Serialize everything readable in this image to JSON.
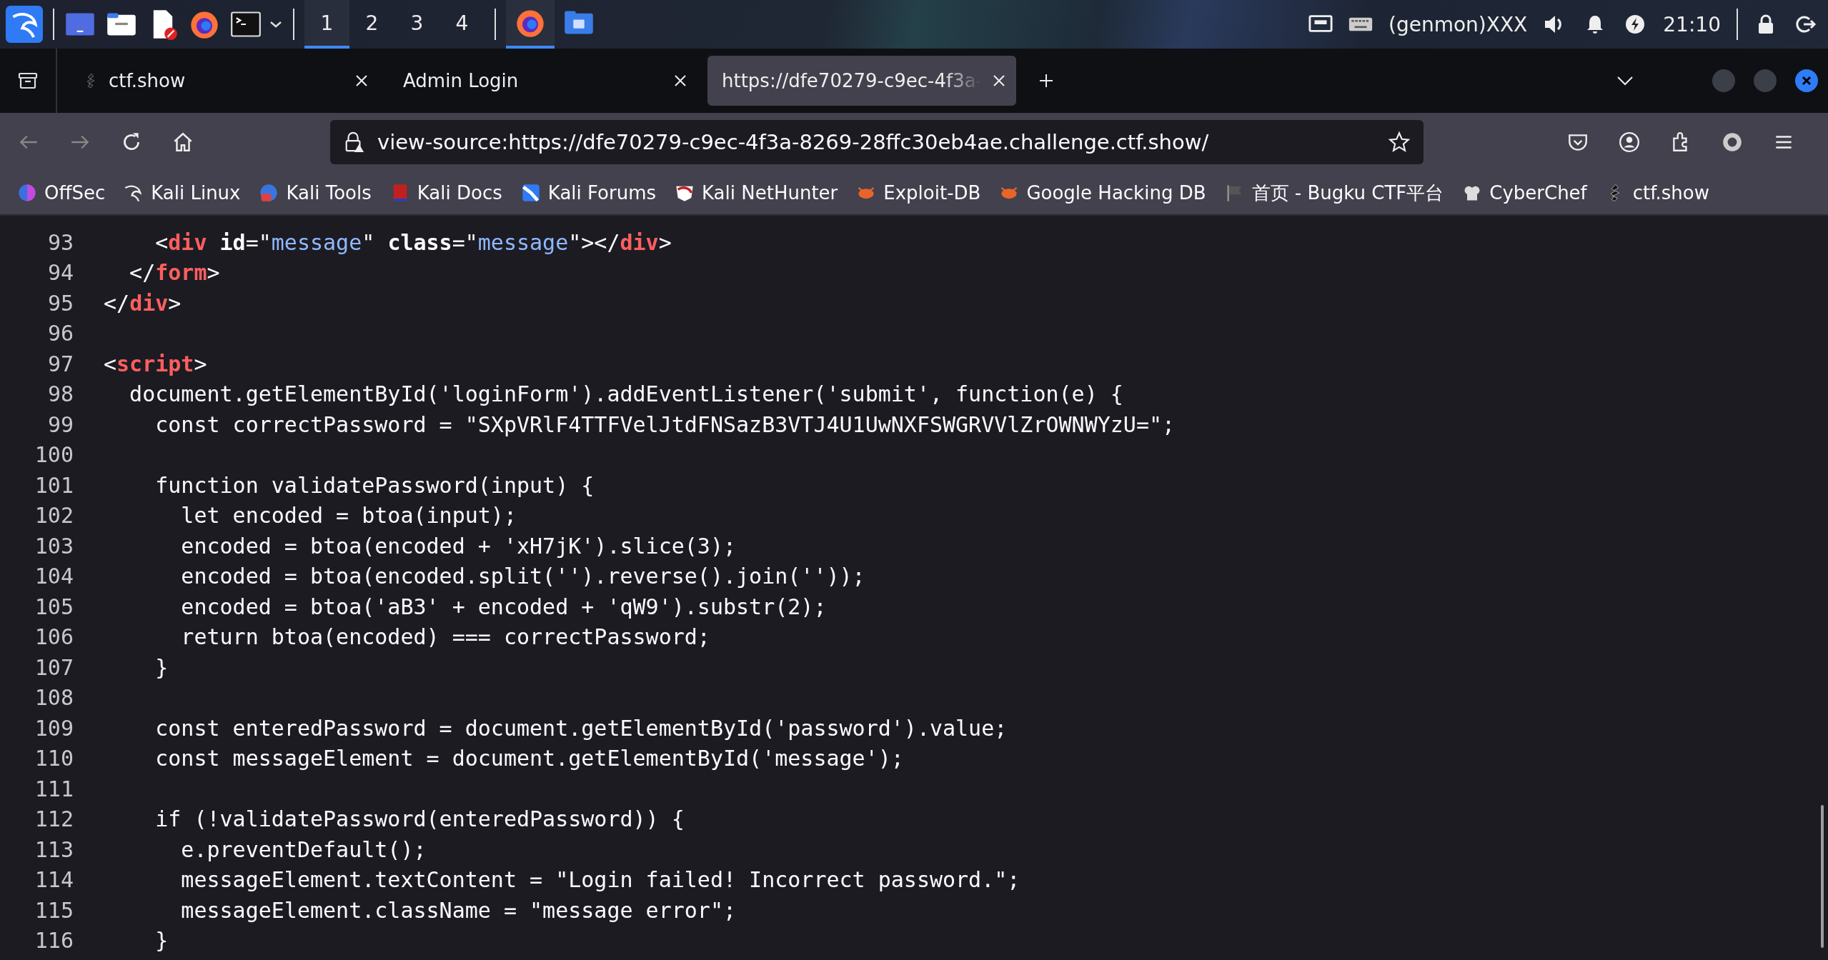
{
  "taskbar": {
    "workspaces": [
      {
        "label": "1",
        "selected": true
      },
      {
        "label": "2",
        "selected": false
      },
      {
        "label": "3",
        "selected": false
      },
      {
        "label": "4",
        "selected": false
      }
    ],
    "windows": [
      {
        "selected": true
      },
      {
        "selected": false
      }
    ],
    "genmon": "(genmon)XXX",
    "clock": "21:10"
  },
  "tabs": [
    {
      "label": "ctf.show",
      "selected": false
    },
    {
      "label": "Admin Login",
      "selected": false
    },
    {
      "label": "https://dfe70279-c9ec-4f3a-",
      "selected": true
    }
  ],
  "address": "view-source:https://dfe70279-c9ec-4f3a-8269-28ffc30eb4ae.challenge.ctf.show/",
  "bookmarks": [
    "OffSec",
    "Kali Linux",
    "Kali Tools",
    "Kali Docs",
    "Kali Forums",
    "Kali NetHunter",
    "Exploit-DB",
    "Google Hacking DB",
    "首页 - Bugku CTF平台",
    "CyberChef",
    "ctf.show"
  ],
  "code_lines": [
    {
      "number": "93",
      "tokens": [
        {
          "kind": "text",
          "text": "    <"
        },
        {
          "kind": "tag",
          "text": "div"
        },
        {
          "kind": "attr",
          "text": " id"
        },
        {
          "kind": "text",
          "text": "=\""
        },
        {
          "kind": "value",
          "text": "message"
        },
        {
          "kind": "text",
          "text": "\" "
        },
        {
          "kind": "attr",
          "text": "class"
        },
        {
          "kind": "text",
          "text": "=\""
        },
        {
          "kind": "value",
          "text": "message"
        },
        {
          "kind": "text",
          "text": "\"></"
        },
        {
          "kind": "tag",
          "text": "div"
        },
        {
          "kind": "text",
          "text": ">"
        }
      ]
    },
    {
      "number": "94",
      "tokens": [
        {
          "kind": "text",
          "text": "  </"
        },
        {
          "kind": "tag",
          "text": "form"
        },
        {
          "kind": "text",
          "text": ">"
        }
      ]
    },
    {
      "number": "95",
      "tokens": [
        {
          "kind": "text",
          "text": "</"
        },
        {
          "kind": "tag",
          "text": "div"
        },
        {
          "kind": "text",
          "text": ">"
        }
      ]
    },
    {
      "number": "96"
    },
    {
      "number": "97",
      "tokens": [
        {
          "kind": "text",
          "text": "<"
        },
        {
          "kind": "tag",
          "text": "script"
        },
        {
          "kind": "text",
          "text": ">"
        }
      ]
    },
    {
      "number": "98",
      "tokens": [
        {
          "kind": "text",
          "text": "  document.getElementById('loginForm').addEventListener('submit', function(e) {"
        }
      ]
    },
    {
      "number": "99",
      "tokens": [
        {
          "kind": "text",
          "text": "    const correctPassword = \"SXpVRlF4TTFVelJtdFNSazB3VTJ4U1UwNXFSWGRVVlZrOWNWYzU=\";"
        }
      ]
    },
    {
      "number": "100"
    },
    {
      "number": "101",
      "tokens": [
        {
          "kind": "text",
          "text": "    function validatePassword(input) {"
        }
      ]
    },
    {
      "number": "102",
      "tokens": [
        {
          "kind": "text",
          "text": "      let encoded = btoa(input);"
        }
      ]
    },
    {
      "number": "103",
      "tokens": [
        {
          "kind": "text",
          "text": "      encoded = btoa(encoded + 'xH7jK').slice(3);"
        }
      ]
    },
    {
      "number": "104",
      "tokens": [
        {
          "kind": "text",
          "text": "      encoded = btoa(encoded.split('').reverse().join(''));"
        }
      ]
    },
    {
      "number": "105",
      "tokens": [
        {
          "kind": "text",
          "text": "      encoded = btoa('aB3' + encoded + 'qW9').substr(2);"
        }
      ]
    },
    {
      "number": "106",
      "tokens": [
        {
          "kind": "text",
          "text": "      return btoa(encoded) === correctPassword;"
        }
      ]
    },
    {
      "number": "107",
      "tokens": [
        {
          "kind": "text",
          "text": "    }"
        }
      ]
    },
    {
      "number": "108"
    },
    {
      "number": "109",
      "tokens": [
        {
          "kind": "text",
          "text": "    const enteredPassword = document.getElementById('password').value;"
        }
      ]
    },
    {
      "number": "110",
      "tokens": [
        {
          "kind": "text",
          "text": "    const messageElement = document.getElementById('message');"
        }
      ]
    },
    {
      "number": "111"
    },
    {
      "number": "112",
      "tokens": [
        {
          "kind": "text",
          "text": "    if (!validatePassword(enteredPassword)) {"
        }
      ]
    },
    {
      "number": "113",
      "tokens": [
        {
          "kind": "text",
          "text": "      e.preventDefault();"
        }
      ]
    },
    {
      "number": "114",
      "tokens": [
        {
          "kind": "text",
          "text": "      messageElement.textContent = \"Login failed! Incorrect password.\";"
        }
      ]
    },
    {
      "number": "115",
      "tokens": [
        {
          "kind": "text",
          "text": "      messageElement.className = \"message error\";"
        }
      ]
    },
    {
      "number": "116",
      "tokens": [
        {
          "kind": "text",
          "text": "    }"
        }
      ]
    }
  ]
}
